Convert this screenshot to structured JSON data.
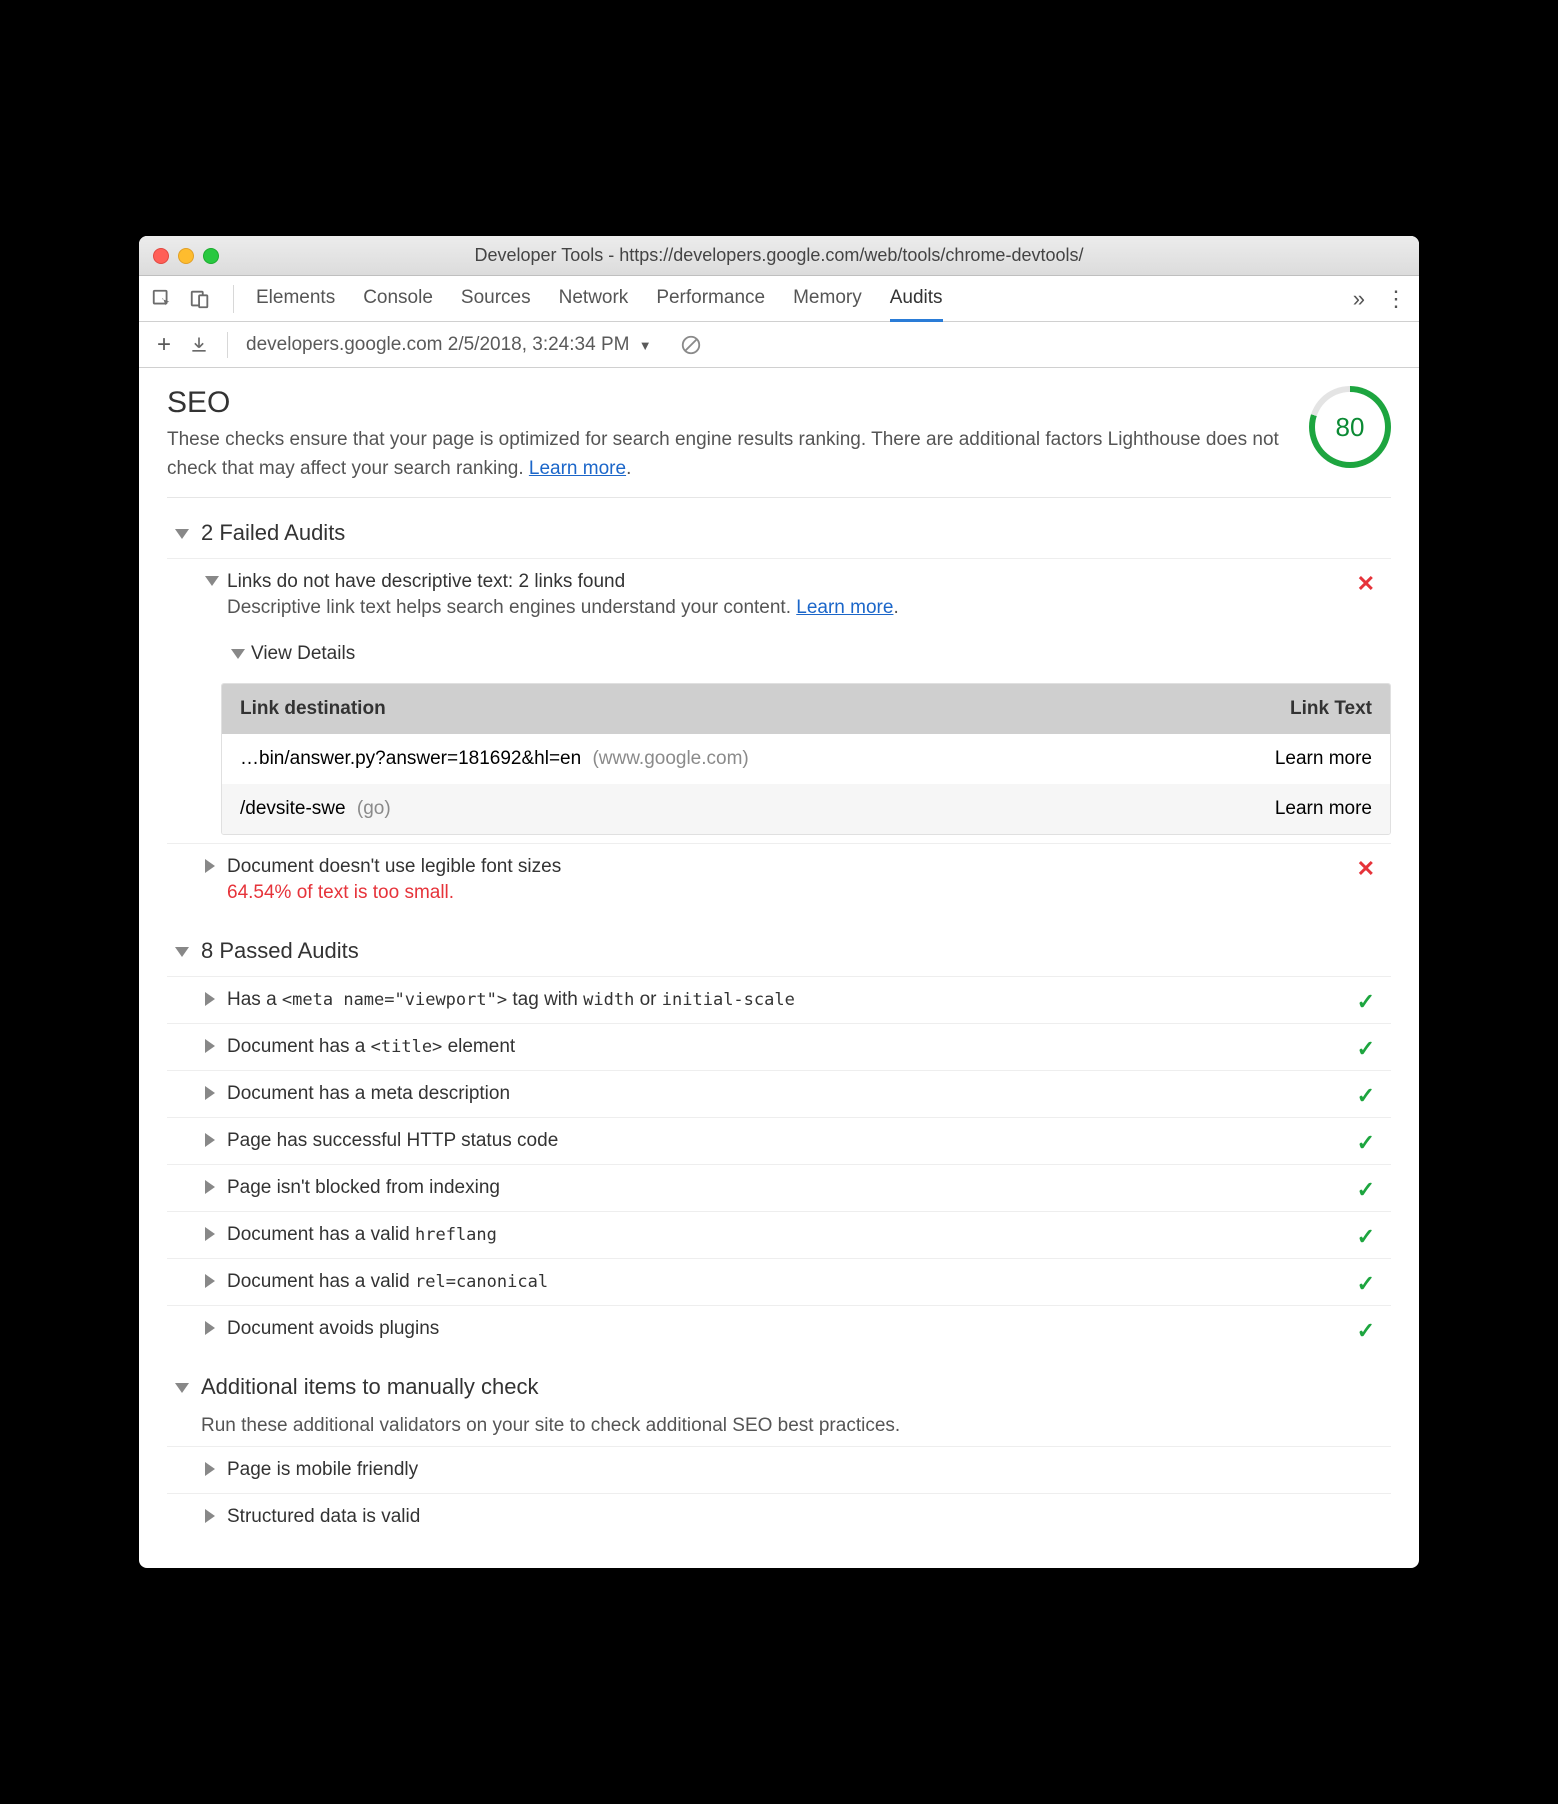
{
  "window_title": "Developer Tools - https://developers.google.com/web/tools/chrome-devtools/",
  "tabs": [
    "Elements",
    "Console",
    "Sources",
    "Network",
    "Performance",
    "Memory",
    "Audits"
  ],
  "active_tab": "Audits",
  "toolbar": {
    "report_label": "developers.google.com 2/5/2018, 3:24:34 PM"
  },
  "seo": {
    "heading": "SEO",
    "description_a": "These checks ensure that your page is optimized for search engine results ranking. There are additional factors Lighthouse does not check that may affect your search ranking. ",
    "learn_more": "Learn more",
    "score": "80"
  },
  "failed": {
    "heading": "2 Failed Audits",
    "items": [
      {
        "title": "Links do not have descriptive text: 2 links found",
        "sub_a": "Descriptive link text helps search engines understand your content. ",
        "learn_more": "Learn more",
        "expanded": true,
        "details_label": "View Details",
        "table": {
          "col1": "Link destination",
          "col2": "Link Text",
          "rows": [
            {
              "dest": "…bin/answer.py?answer=181692&hl=en",
              "host": "(www.google.com)",
              "text": "Learn more"
            },
            {
              "dest": "/devsite-swe",
              "host": "(go)",
              "text": "Learn more"
            }
          ]
        }
      },
      {
        "title": "Document doesn't use legible font sizes",
        "sub": "64.54% of text is too small.",
        "expanded": false
      }
    ]
  },
  "passed": {
    "heading": "8 Passed Audits",
    "items": [
      {
        "pre": "Has a ",
        "code": "<meta name=\"viewport\">",
        "mid": " tag with ",
        "code2": "width",
        "mid2": " or ",
        "code3": "initial-scale"
      },
      {
        "pre": "Document has a ",
        "code": "<title>",
        "post": " element"
      },
      {
        "text": "Document has a meta description"
      },
      {
        "text": "Page has successful HTTP status code"
      },
      {
        "text": "Page isn't blocked from indexing"
      },
      {
        "pre": "Document has a valid ",
        "code": "hreflang"
      },
      {
        "pre": "Document has a valid ",
        "code": "rel=canonical"
      },
      {
        "text": "Document avoids plugins"
      }
    ]
  },
  "manual": {
    "heading": "Additional items to manually check",
    "description": "Run these additional validators on your site to check additional SEO best practices.",
    "items": [
      {
        "text": "Page is mobile friendly"
      },
      {
        "text": "Structured data is valid"
      }
    ]
  }
}
